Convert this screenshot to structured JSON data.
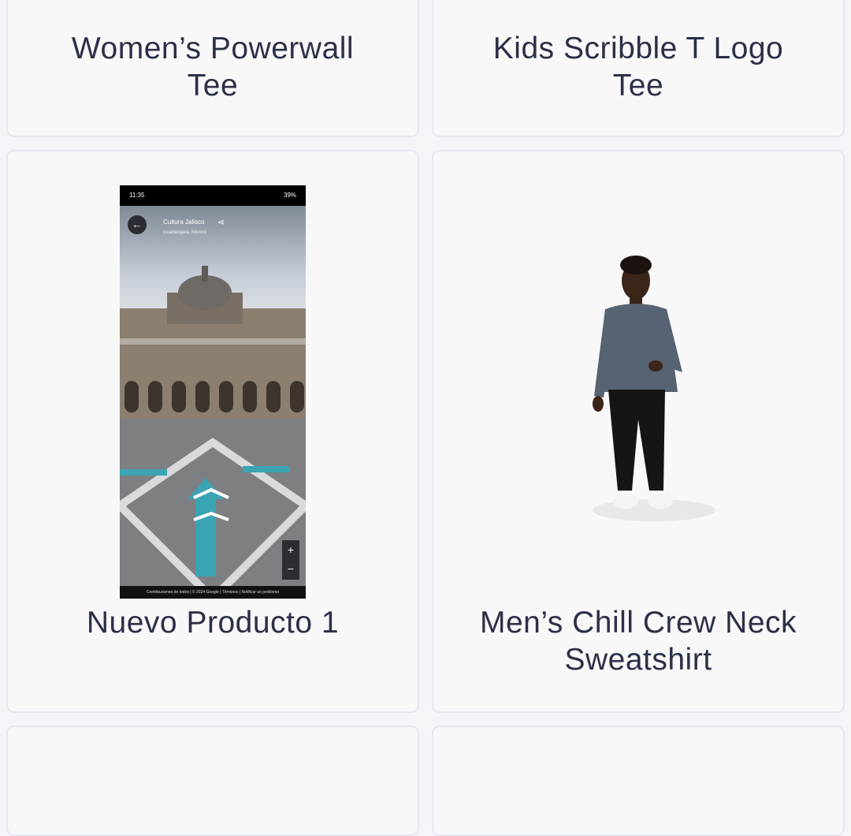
{
  "products": [
    {
      "name": "Women’s Powerwall Tee"
    },
    {
      "name": "Kids Scribble T Logo Tee"
    },
    {
      "name": "Nuevo Producto 1",
      "thumbnail": {
        "status_time": "11:35",
        "status_right": "39%",
        "place_title": "Cultura Jalisco",
        "place_subtitle": "Guadalajara, México",
        "footer": "Contribuciones de todos | © 2024 Google | Términos | Notificar un problema"
      }
    },
    {
      "name": "Men’s Chill Crew Neck Sweatshirt"
    }
  ],
  "icons": {
    "back": "arrow-left-icon",
    "share": "share-icon",
    "zoom_in": "plus-icon",
    "zoom_out": "minus-icon"
  }
}
